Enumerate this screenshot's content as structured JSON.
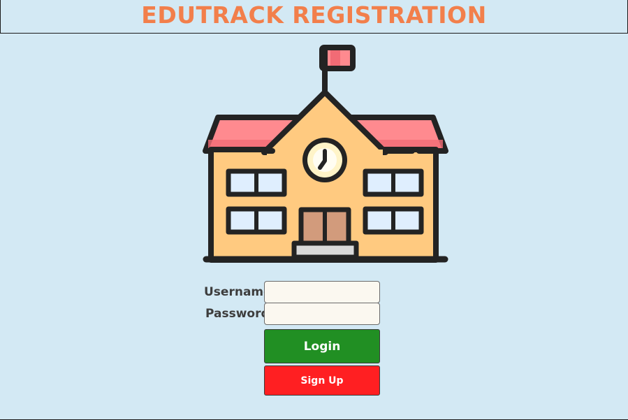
{
  "header": {
    "title": "EDUTRACK REGISTRATION"
  },
  "illustration": {
    "icon": "school-building-icon"
  },
  "form": {
    "username_label": "Username",
    "username_value": "",
    "password_label": "Password",
    "password_value": "",
    "login_label": "Login",
    "signup_label": "Sign Up"
  },
  "colors": {
    "background": "#d3e9f4",
    "title": "#f27f4b",
    "login_button": "#218f23",
    "signup_button": "#ff1f22",
    "input_background": "#fbf8f0"
  }
}
